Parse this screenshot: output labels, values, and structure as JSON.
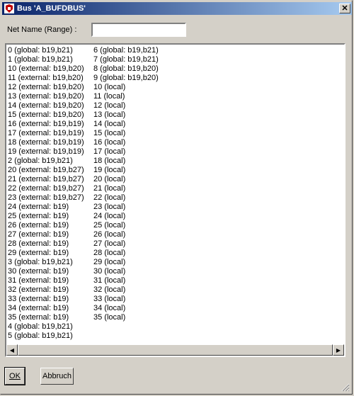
{
  "window": {
    "title": "Bus 'A_BUFDBUS'",
    "close_glyph": "✕"
  },
  "form": {
    "net_name_label": "Net Name (Range) :",
    "net_name_value": ""
  },
  "list": {
    "col1": [
      "0 (global: b19,b21)",
      "1 (global: b19,b21)",
      "10 (external: b19,b20)",
      "11 (external: b19,b20)",
      "12 (external: b19,b20)",
      "13 (external: b19,b20)",
      "14 (external: b19,b20)",
      "15 (external: b19,b20)",
      "16 (external: b19,b19)",
      "17 (external: b19,b19)",
      "18 (external: b19,b19)",
      "19 (external: b19,b19)",
      "2 (global: b19,b21)",
      "20 (external: b19,b27)",
      "21 (external: b19,b27)",
      "22 (external: b19,b27)",
      "23 (external: b19,b27)",
      "24 (external: b19)",
      "25 (external: b19)",
      "26 (external: b19)",
      "27 (external: b19)",
      "28 (external: b19)",
      "29 (external: b19)",
      "3 (global: b19,b21)",
      "30 (external: b19)",
      "31 (external: b19)",
      "32 (external: b19)",
      "33 (external: b19)",
      "34 (external: b19)",
      "35 (external: b19)",
      "4 (global: b19,b21)",
      "5 (global: b19,b21)"
    ],
    "col2": [
      "6 (global: b19,b21)",
      "7 (global: b19,b21)",
      "8 (global: b19,b20)",
      "9 (global: b19,b20)",
      "10 (local)",
      "11 (local)",
      "12 (local)",
      "13 (local)",
      "14 (local)",
      "15 (local)",
      "16 (local)",
      "17 (local)",
      "18 (local)",
      "19 (local)",
      "20 (local)",
      "21 (local)",
      "22 (local)",
      "23 (local)",
      "24 (local)",
      "25 (local)",
      "26 (local)",
      "27 (local)",
      "28 (local)",
      "29 (local)",
      "30 (local)",
      "31 (local)",
      "32 (local)",
      "33 (local)",
      "34 (local)",
      "35 (local)"
    ]
  },
  "buttons": {
    "ok": "OK",
    "cancel": "Abbruch"
  },
  "icons": {
    "scroll_left": "◀",
    "scroll_right": "▶"
  },
  "colors": {
    "title_start": "#0a246a",
    "title_end": "#a6caf0",
    "face": "#d4d0c8"
  }
}
